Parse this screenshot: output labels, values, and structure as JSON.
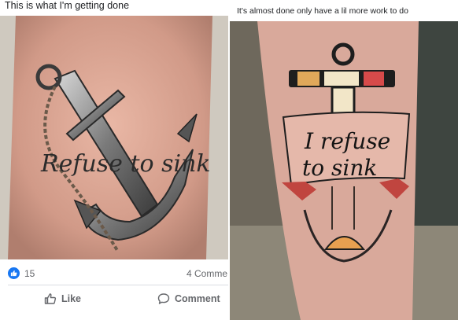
{
  "captions": {
    "left": "This is what I'm getting done",
    "right": "It's almost done only have a lil more work to do"
  },
  "tattoo_left": {
    "text": "Refuse to sink"
  },
  "tattoo_right": {
    "line1": "I refuse",
    "line2": "to sink"
  },
  "post": {
    "reaction_count": "15",
    "comment_count": "4 Comme",
    "like_label": "Like",
    "comment_label": "Comment"
  },
  "colors": {
    "facebook_blue": "#1877f2",
    "muted_text": "#65676b"
  }
}
